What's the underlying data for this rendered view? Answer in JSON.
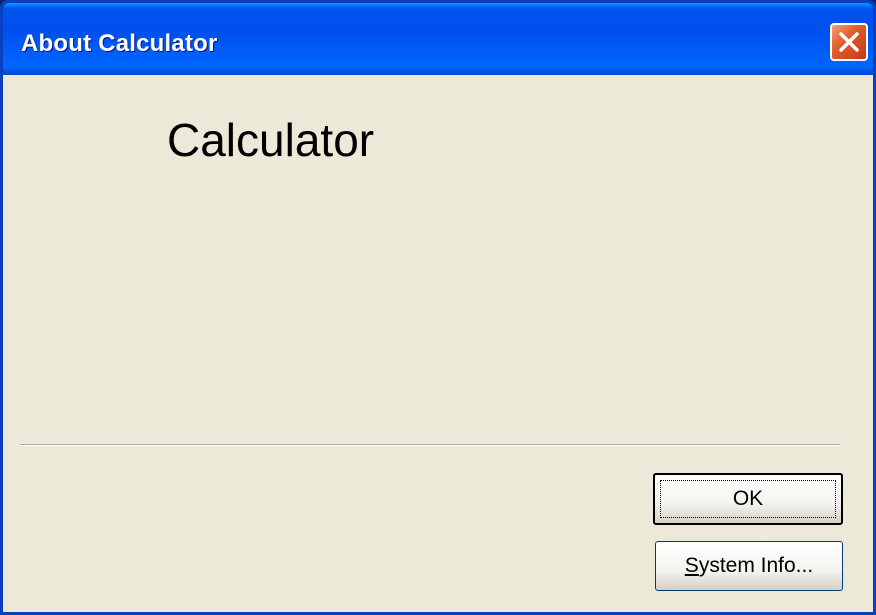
{
  "window": {
    "title": "About Calculator",
    "close_icon": "close-x-icon",
    "colors": {
      "titlebar": "#0055ea",
      "client_background": "#ece9d8",
      "close_button": "#e35d2c"
    }
  },
  "content": {
    "app_name": "Calculator"
  },
  "buttons": {
    "ok_label": "OK",
    "system_info_label": "System Info..."
  }
}
